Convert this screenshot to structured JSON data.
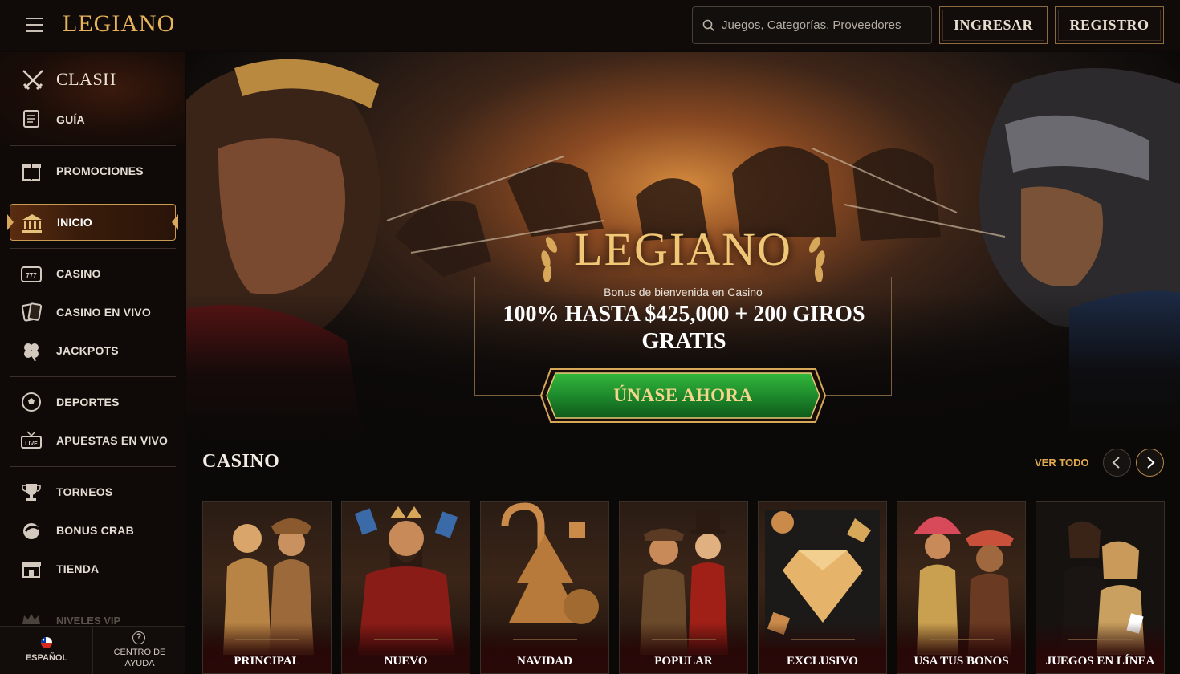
{
  "header": {
    "logo": "LEGIANO",
    "search_placeholder": "Juegos, Categorías, Proveedores",
    "login_label": "INGRESAR",
    "register_label": "REGISTRO"
  },
  "sidebar": {
    "clash": {
      "title": "CLASH",
      "icon": "crossed-swords-icon"
    },
    "items": [
      {
        "label": "GUÍA",
        "icon": "scroll-icon"
      },
      {
        "label": "PROMOCIONES",
        "icon": "gift-icon"
      },
      {
        "label": "INICIO",
        "icon": "temple-icon",
        "active": true
      },
      {
        "label": "CASINO",
        "icon": "slot-machine-icon"
      },
      {
        "label": "CASINO EN VIVO",
        "icon": "cards-icon"
      },
      {
        "label": "JACKPOTS",
        "icon": "clover-icon"
      },
      {
        "label": "DEPORTES",
        "icon": "soccer-ball-icon"
      },
      {
        "label": "APUESTAS EN VIVO",
        "icon": "live-tv-icon"
      },
      {
        "label": "TORNEOS",
        "icon": "trophy-icon"
      },
      {
        "label": "BONUS CRAB",
        "icon": "claw-icon"
      },
      {
        "label": "TIENDA",
        "icon": "shop-icon"
      },
      {
        "label": "NIVELES VIP",
        "icon": "crown-icon"
      }
    ],
    "bottom": {
      "language": "ESPAÑOL",
      "help_line1": "CENTRO DE",
      "help_line2": "AYUDA"
    }
  },
  "hero": {
    "logo": "LEGIANO",
    "subtitle": "Bonus de bienvenida en Casino",
    "title": "100% HASTA $425,000 + 200 GIROS GRATIS",
    "cta": "ÚNASE AHORA"
  },
  "casino": {
    "title": "CASINO",
    "view_all": "VER TODO",
    "cards": [
      {
        "label": "PRINCIPAL"
      },
      {
        "label": "NUEVO"
      },
      {
        "label": "NAVIDAD"
      },
      {
        "label": "POPULAR"
      },
      {
        "label": "EXCLUSIVO"
      },
      {
        "label": "USA TUS BONOS"
      },
      {
        "label": "JUEGOS EN LÍNEA"
      }
    ]
  },
  "colors": {
    "accent_gold": "#e0a84f",
    "cta_green": "#1e8a2c",
    "background": "#0b0908"
  }
}
